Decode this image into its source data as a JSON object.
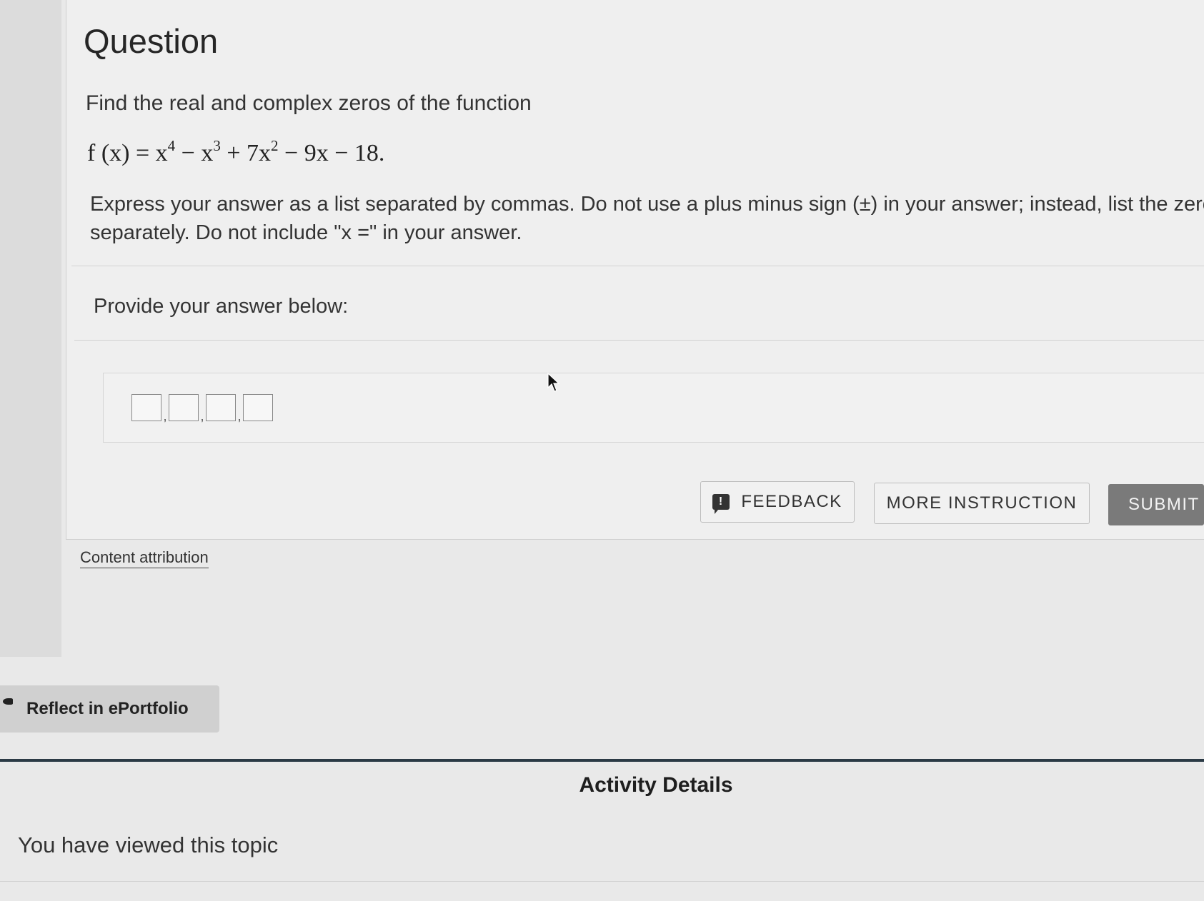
{
  "question": {
    "title": "Question",
    "prompt": "Find the real and complex zeros of the function",
    "formula": {
      "lhs": "f (x) = x",
      "exp1": "4",
      "part2": " − x",
      "exp2": "3",
      "part3": " + 7x",
      "exp3": "2",
      "part4": " − 9x − 18."
    },
    "instructions_line1": "Express your answer as a list separated by commas. Do not use a plus minus sign (±) in your answer; instead, list the zero",
    "instructions_line2": "separately. Do not include \"x =\" in your answer."
  },
  "answer": {
    "provide_label": "Provide your answer below:",
    "separator": ",",
    "slot_count": 4
  },
  "buttons": {
    "feedback_label": "FEEDBACK",
    "feedback_icon": "!",
    "more_instruction_label": "MORE INSTRUCTION",
    "submit_label": "SUBMIT"
  },
  "attribution_label": "Content attribution",
  "reflect_label": "Reflect in ePortfolio",
  "activity": {
    "title": "Activity Details",
    "viewed_text": "You have viewed this topic"
  },
  "icons": {
    "feedback": "exclamation-speech-bubble-icon",
    "reflect": "pen-icon",
    "cursor": "mouse-pointer-icon"
  },
  "colors": {
    "submit_bg": "#7a7a7a",
    "activity_rule": "#2b3a45",
    "page_bg": "#e9e9e9"
  }
}
